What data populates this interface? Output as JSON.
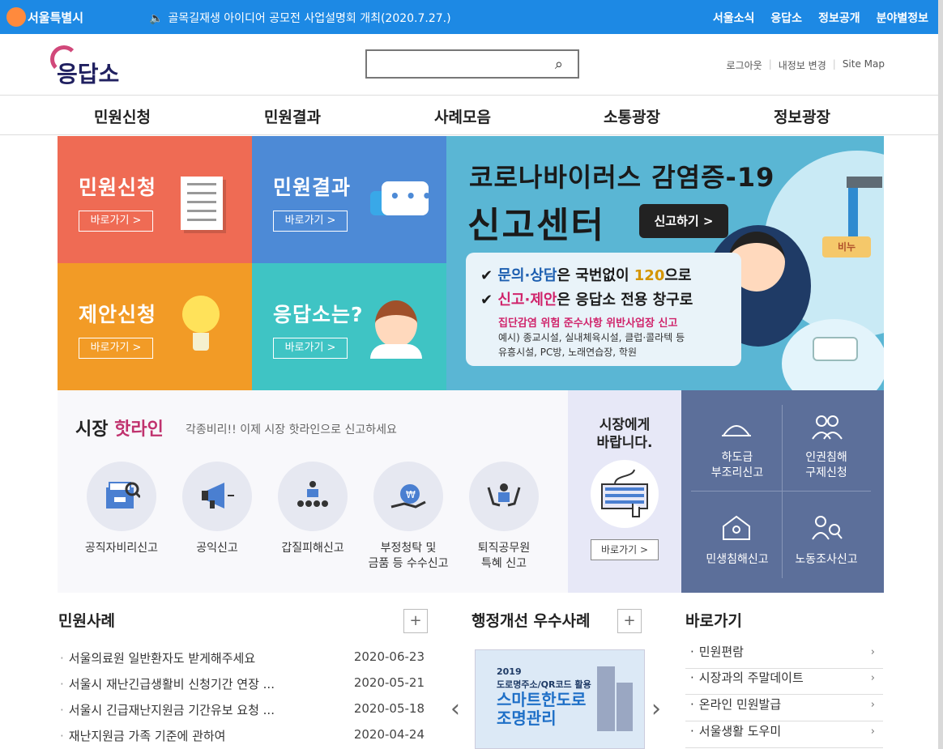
{
  "topbar": {
    "brand": "서울특별시",
    "notice": "골목길재생 아이디어 공모전 사업설명회 개최(2020.7.27.)",
    "links": [
      "서울소식",
      "응답소",
      "정보공개",
      "분야별정보"
    ]
  },
  "header": {
    "logo": "응답소",
    "search_placeholder": "",
    "utils": [
      "로그아웃",
      "내정보 변경",
      "Site Map"
    ]
  },
  "gnb": [
    "민원신청",
    "민원결과",
    "사례모음",
    "소통광장",
    "정보광장"
  ],
  "tiles": [
    {
      "title": "민원신청",
      "button": "바로가기 >"
    },
    {
      "title": "민원결과",
      "button": "바로가기 >"
    },
    {
      "title": "제안신청",
      "button": "바로가기 >"
    },
    {
      "title": "응답소는?",
      "button": "바로가기 >"
    }
  ],
  "banner": {
    "title1": "코로나바이러스 감염증-19",
    "title2": "신고센터",
    "button": "신고하기 >",
    "line1_a": "문의·상담",
    "line1_b": "은 국번없이 ",
    "line1_c": "120",
    "line1_d": "으로",
    "line2_a": "신고·제안",
    "line2_b": "은 응답소 전용 창구로",
    "red": "집단감염 위험 준수사항 위반사업장 신고",
    "small1": "예시) 종교시설, 실내체육시설, 클럽·콜라텍 등",
    "small2": "유흥시설, PC방, 노래연습장, 학원",
    "soap": "비누"
  },
  "hotline": {
    "title_a": "시장",
    "title_b": "핫라인",
    "subtitle": "각종비리!! 이제 시장 핫라인으로 신고하세요",
    "items": [
      {
        "label1": "공직자비리신고",
        "label2": ""
      },
      {
        "label1": "공익신고",
        "label2": ""
      },
      {
        "label1": "갑질피해신고",
        "label2": ""
      },
      {
        "label1": "부정청탁 및",
        "label2": "금품 등 수수신고"
      },
      {
        "label1": "퇴직공무원",
        "label2": "특혜 신고"
      }
    ]
  },
  "mayor": {
    "title1": "시장에게",
    "title2": "바랍니다.",
    "button": "바로가기 >"
  },
  "grid4": [
    {
      "label1": "하도급",
      "label2": "부조리신고"
    },
    {
      "label1": "인권침해",
      "label2": "구제신청"
    },
    {
      "label1": "민생침해신고",
      "label2": ""
    },
    {
      "label1": "노동조사신고",
      "label2": ""
    }
  ],
  "cases": {
    "title": "민원사례",
    "plus": "+",
    "items": [
      {
        "text": "서울의료원 일반환자도 받게해주세요",
        "date": "2020-06-23"
      },
      {
        "text": "서울시 재난긴급생활비 신청기간 연장 ...",
        "date": "2020-05-21"
      },
      {
        "text": "서울시 긴급재난지원금 기간유보 요청 ...",
        "date": "2020-05-18"
      },
      {
        "text": "재난지원금 가족 기준에 관하여",
        "date": "2020-04-24"
      }
    ]
  },
  "admin": {
    "title": "행정개선 우수사례",
    "plus": "+",
    "card_year": "2019",
    "card_sub": "도로명주소/QR코드 활용",
    "card_main1": "스마트한도로",
    "card_main2": "조명관리",
    "prev": "‹",
    "next": "›"
  },
  "quick": {
    "title": "바로가기",
    "items": [
      "민원편람",
      "시장과의 주말데이트",
      "온라인 민원발급",
      "서울생활 도우미"
    ]
  }
}
